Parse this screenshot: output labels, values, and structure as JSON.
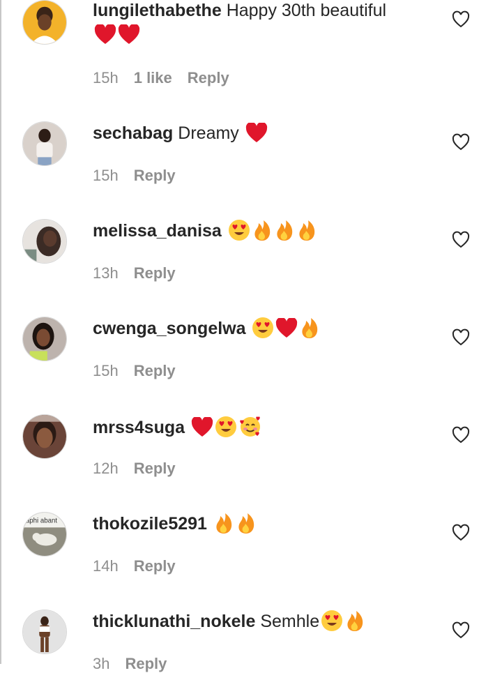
{
  "comments": [
    {
      "username": "lungilethabethe",
      "text": "Happy 30th beautiful",
      "emojis": [
        "red-heart",
        "red-heart"
      ],
      "time": "15h",
      "likes": "1 like",
      "reply": "Reply",
      "avatar_bg": "#f3b22a"
    },
    {
      "username": "sechabag",
      "text": "Dreamy",
      "emojis": [
        "red-heart"
      ],
      "time": "15h",
      "likes": "",
      "reply": "Reply",
      "avatar_bg": "#d9d1cb"
    },
    {
      "username": "melissa_danisa",
      "text": "",
      "emojis": [
        "heart-eyes",
        "fire",
        "fire",
        "fire"
      ],
      "time": "13h",
      "likes": "",
      "reply": "Reply",
      "avatar_bg": "#3b2b25"
    },
    {
      "username": "cwenga_songelwa",
      "text": "",
      "emojis": [
        "heart-eyes",
        "red-heart",
        "fire"
      ],
      "time": "15h",
      "likes": "",
      "reply": "Reply",
      "avatar_bg": "#bdb3ad"
    },
    {
      "username": "mrss4suga",
      "text": "",
      "emojis": [
        "red-heart",
        "heart-eyes",
        "smiling-hearts"
      ],
      "time": "12h",
      "likes": "",
      "reply": "Reply",
      "avatar_bg": "#6a4438"
    },
    {
      "username": "thokozile5291",
      "text": "",
      "emojis": [
        "fire",
        "fire"
      ],
      "time": "14h",
      "likes": "",
      "reply": "Reply",
      "avatar_bg": "#8f8d80",
      "avatar_caption": "aphi abant"
    },
    {
      "username": "thicklunathi_nokele",
      "text": "Semhle",
      "emojis": [
        "heart-eyes",
        "fire"
      ],
      "time": "3h",
      "likes": "",
      "reply": "Reply",
      "avatar_bg": "#d7d7d7"
    }
  ],
  "icons": {
    "like": "heart-outline-icon"
  },
  "colors": {
    "text": "#262626",
    "meta": "#8e8e8e",
    "heart": "#e0162b",
    "fire": "#f7941d"
  }
}
